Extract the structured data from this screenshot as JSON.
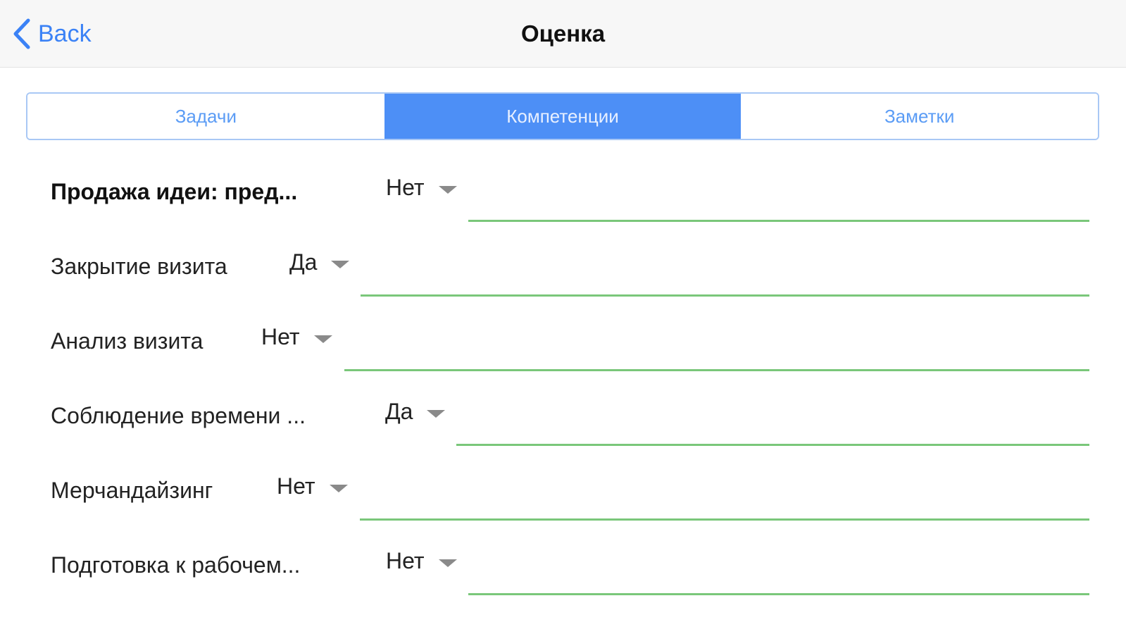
{
  "navbar": {
    "back_label": "Back",
    "title": "Оценка"
  },
  "tabs": [
    {
      "label": "Задачи",
      "active": false
    },
    {
      "label": "Компетенции",
      "active": true
    },
    {
      "label": "Заметки",
      "active": false
    }
  ],
  "rows": [
    {
      "label": "Продажа идеи: пред...",
      "value": "Нет",
      "bold": true
    },
    {
      "label": "Закрытие визита",
      "value": "Да",
      "bold": false
    },
    {
      "label": "Анализ визита",
      "value": "Нет",
      "bold": false
    },
    {
      "label": "Соблюдение времени ...",
      "value": "Да",
      "bold": false
    },
    {
      "label": "Мерчандайзинг",
      "value": "Нет",
      "bold": false
    },
    {
      "label": "Подготовка к рабочем...",
      "value": "Нет",
      "bold": false
    }
  ],
  "colors": {
    "accent": "#4d8ff6",
    "field_underline": "#7ac77a"
  },
  "icons": {
    "back": "chevron-left-icon",
    "picker": "caret-down-icon"
  }
}
